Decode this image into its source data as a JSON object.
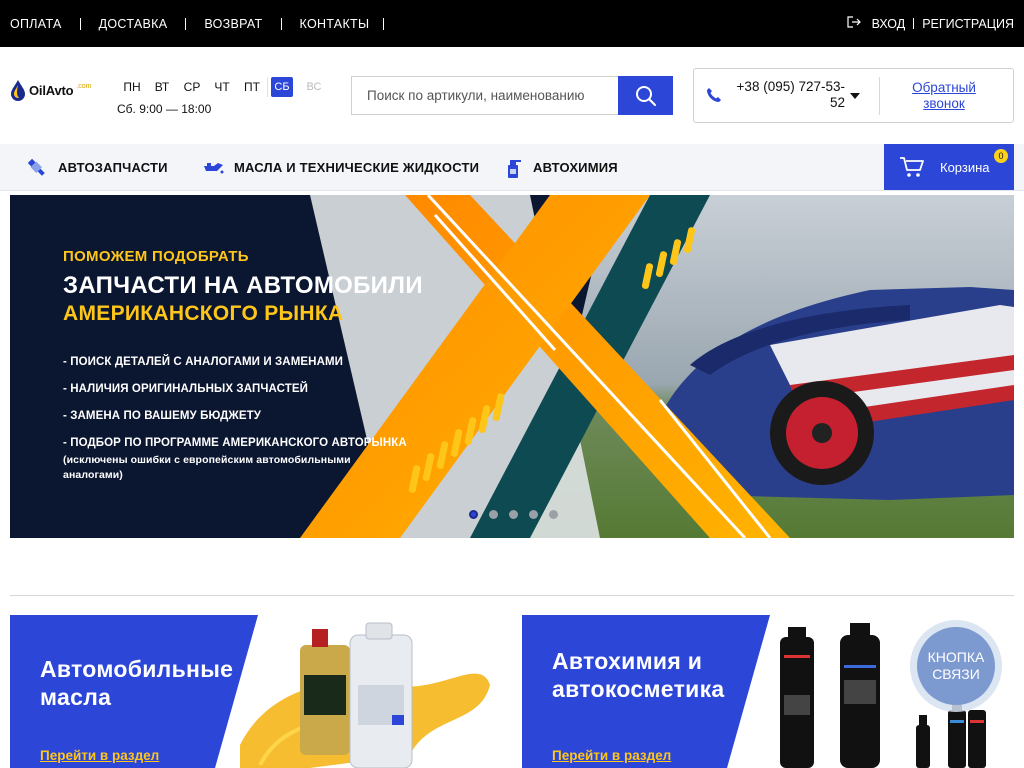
{
  "topbar": {
    "links": [
      "ОПЛАТА",
      "ДОСТАВКА",
      "ВОЗВРАТ",
      "КОНТАКТЫ"
    ],
    "login": "ВХОД",
    "register": "РЕГИСТРАЦИЯ",
    "login_icon": "login-arrow-icon"
  },
  "logo": {
    "brand": "OilAvto",
    "domain": ".com"
  },
  "schedule": {
    "days": [
      "ПН",
      "ВТ",
      "СР",
      "ЧТ",
      "ПТ"
    ],
    "today": "СБ",
    "off_day": "ВС",
    "hours": "Сб. 9:00 — 18:00"
  },
  "search": {
    "placeholder": "Поиск по артикули, наименованию",
    "value": "",
    "icon": "search-icon"
  },
  "contact": {
    "phone": "+38 (095) 727-53-52",
    "callback": "Обратный звонок",
    "phone_icon": "phone-icon"
  },
  "nav": {
    "items": [
      {
        "label": "АВТОЗАПЧАСТИ",
        "icon": "spark-plug-icon"
      },
      {
        "label": "МАСЛА И ТЕХНИЧЕСКИЕ ЖИДКОСТИ",
        "icon": "oil-can-icon"
      },
      {
        "label": "АВТОХИМИЯ",
        "icon": "spray-bottle-icon"
      }
    ],
    "cart_label": "Корзина",
    "cart_count": "0"
  },
  "banner": {
    "pretitle": "ПОМОЖЕМ ПОДОБРАТЬ",
    "title_line1": "ЗАПЧАСТИ НА АВТОМОБИЛИ",
    "title_line2": "АМЕРИКАНСКОГО РЫНКА",
    "bullets": [
      "- ПОИСК ДЕТАЛЕЙ С АНАЛОГАМИ И ЗАМЕНАМИ",
      "- НАЛИЧИЯ ОРИГИНАЛЬНЫХ ЗАПЧАСТЕЙ",
      "- ЗАМЕНА ПО ВАШЕМУ БЮДЖЕТУ",
      "- ПОДБОР ПО ПРОГРАММЕ АМЕРИКАНСКОГО АВТОРЫНКА"
    ],
    "bullet_note": "(исключены ошибки с европейским автомобильными аналогами)",
    "slides_total": 5,
    "active_slide": 1
  },
  "cards": [
    {
      "title": "Автомобильные масла",
      "link": "Перейти в раздел"
    },
    {
      "title": "Автохимия и автокосметика",
      "link": "Перейти в раздел"
    }
  ],
  "callback_widget": "КНОПКА СВЯЗИ",
  "colors": {
    "accent": "#2c46d8",
    "yellow": "#ffc61a",
    "orange": "#ff9a00",
    "topbar": "#000000"
  }
}
